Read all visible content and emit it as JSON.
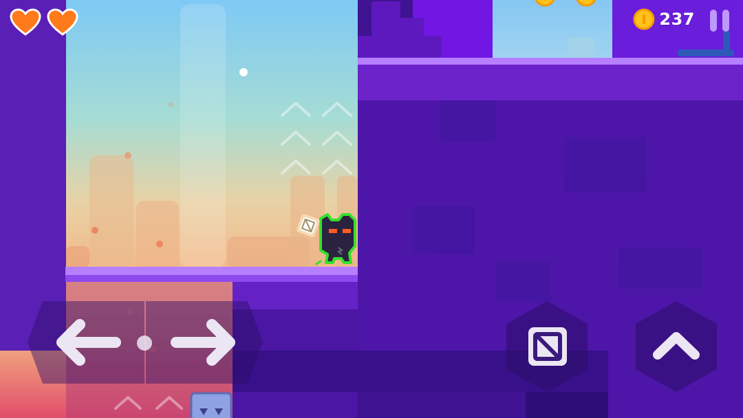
{
  "hud": {
    "lives": 2,
    "coin_count": "237"
  },
  "colors": {
    "heart": "#ff7a1a",
    "coin": "#ffc21a",
    "platform_top": "#b07cff",
    "wall": "#4b13a6",
    "player_outline": "#35e02c"
  },
  "icons": {
    "heart": "heart-icon",
    "coin": "coin-icon",
    "pause": "pause-icon",
    "move_left": "arrow-left-icon",
    "move_right": "arrow-right-icon",
    "dash": "dash-icon",
    "jump": "chevron-up-icon"
  }
}
